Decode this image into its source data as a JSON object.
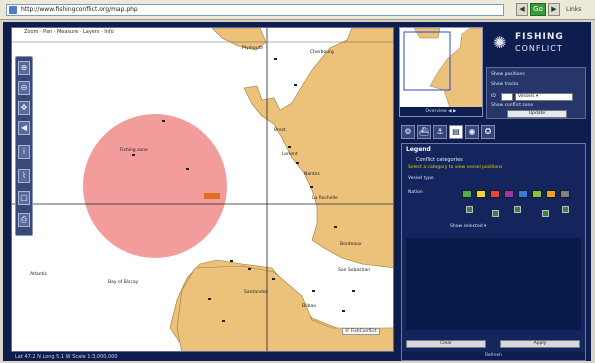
{
  "browser": {
    "address": "http://www.fishingconflict.org/map.php",
    "go_label": "Go",
    "links_label": "Links",
    "back_label": "◀",
    "forward_label": "▶"
  },
  "map": {
    "top_strip": "Zoom · Pan · Measure · Layers · Info",
    "bottom_strip": "Lat 47.2 N  Long 5.1 W   Scale 1:3,000,000",
    "labels": {
      "circle": "Fishing zone",
      "brest": "Brest",
      "lorient": "Lorient",
      "nantes": "Nantes",
      "rochelle": "La Rochelle",
      "bordeaux": "Bordeaux",
      "bilbao": "Bilbao",
      "santander": "Santander",
      "north": "Plymouth",
      "nw": "Cherbourg",
      "sea": "Bay of Biscay",
      "sw": "Atlantic",
      "se": "San Sebastian",
      "copyright": "© FishConflict"
    },
    "colors": {
      "land": "#ecc27a",
      "sea": "#ffffff",
      "circle": "#f08080",
      "gridline": "#222222"
    }
  },
  "toolbar": {
    "tools": [
      {
        "name": "zoom-in-icon",
        "glyph": "⊕"
      },
      {
        "name": "zoom-out-icon",
        "glyph": "⊖"
      },
      {
        "name": "pan-icon",
        "glyph": "✥"
      },
      {
        "name": "back-icon",
        "glyph": "◀"
      },
      {
        "name": "info-icon",
        "glyph": "i"
      },
      {
        "name": "measure-icon",
        "glyph": "⌇"
      },
      {
        "name": "select-icon",
        "glyph": "▢"
      },
      {
        "name": "print-icon",
        "glyph": "⎙"
      }
    ]
  },
  "sidebar": {
    "logo_title": "FISHING",
    "logo_sub": "CONFLICT",
    "overview_caption": "Overview  ◀ ▶",
    "options": {
      "row1": "Show positions",
      "row2": "Show tracks",
      "row3_label": "ID",
      "select_value": "Vessels ▾",
      "row4": "Show conflict zone",
      "button_label": "Update"
    },
    "tabs": [
      {
        "name": "tab-settings",
        "glyph": "⚙"
      },
      {
        "name": "tab-vessels",
        "glyph": "⛴"
      },
      {
        "name": "tab-anchor",
        "glyph": "⚓"
      },
      {
        "name": "tab-layers",
        "glyph": "▤"
      },
      {
        "name": "tab-data",
        "glyph": "◉"
      },
      {
        "name": "tab-globe",
        "glyph": "✪"
      }
    ],
    "panel": {
      "title": "Legend",
      "head": "Conflict  categories",
      "yellow_line": "Select a category to view vessel positions",
      "row1": "Vessel type",
      "row2": "Nation",
      "footer_text": "Show selected  ▾",
      "button_left": "Clear",
      "button_right": "Apply",
      "foot": "Refresh"
    },
    "swatches": [
      "#4cb050",
      "#e8d83a",
      "#e64a3a",
      "#9a3aa0",
      "#3a7ae0",
      "#8ac040",
      "#f0a020",
      "#808080"
    ]
  }
}
